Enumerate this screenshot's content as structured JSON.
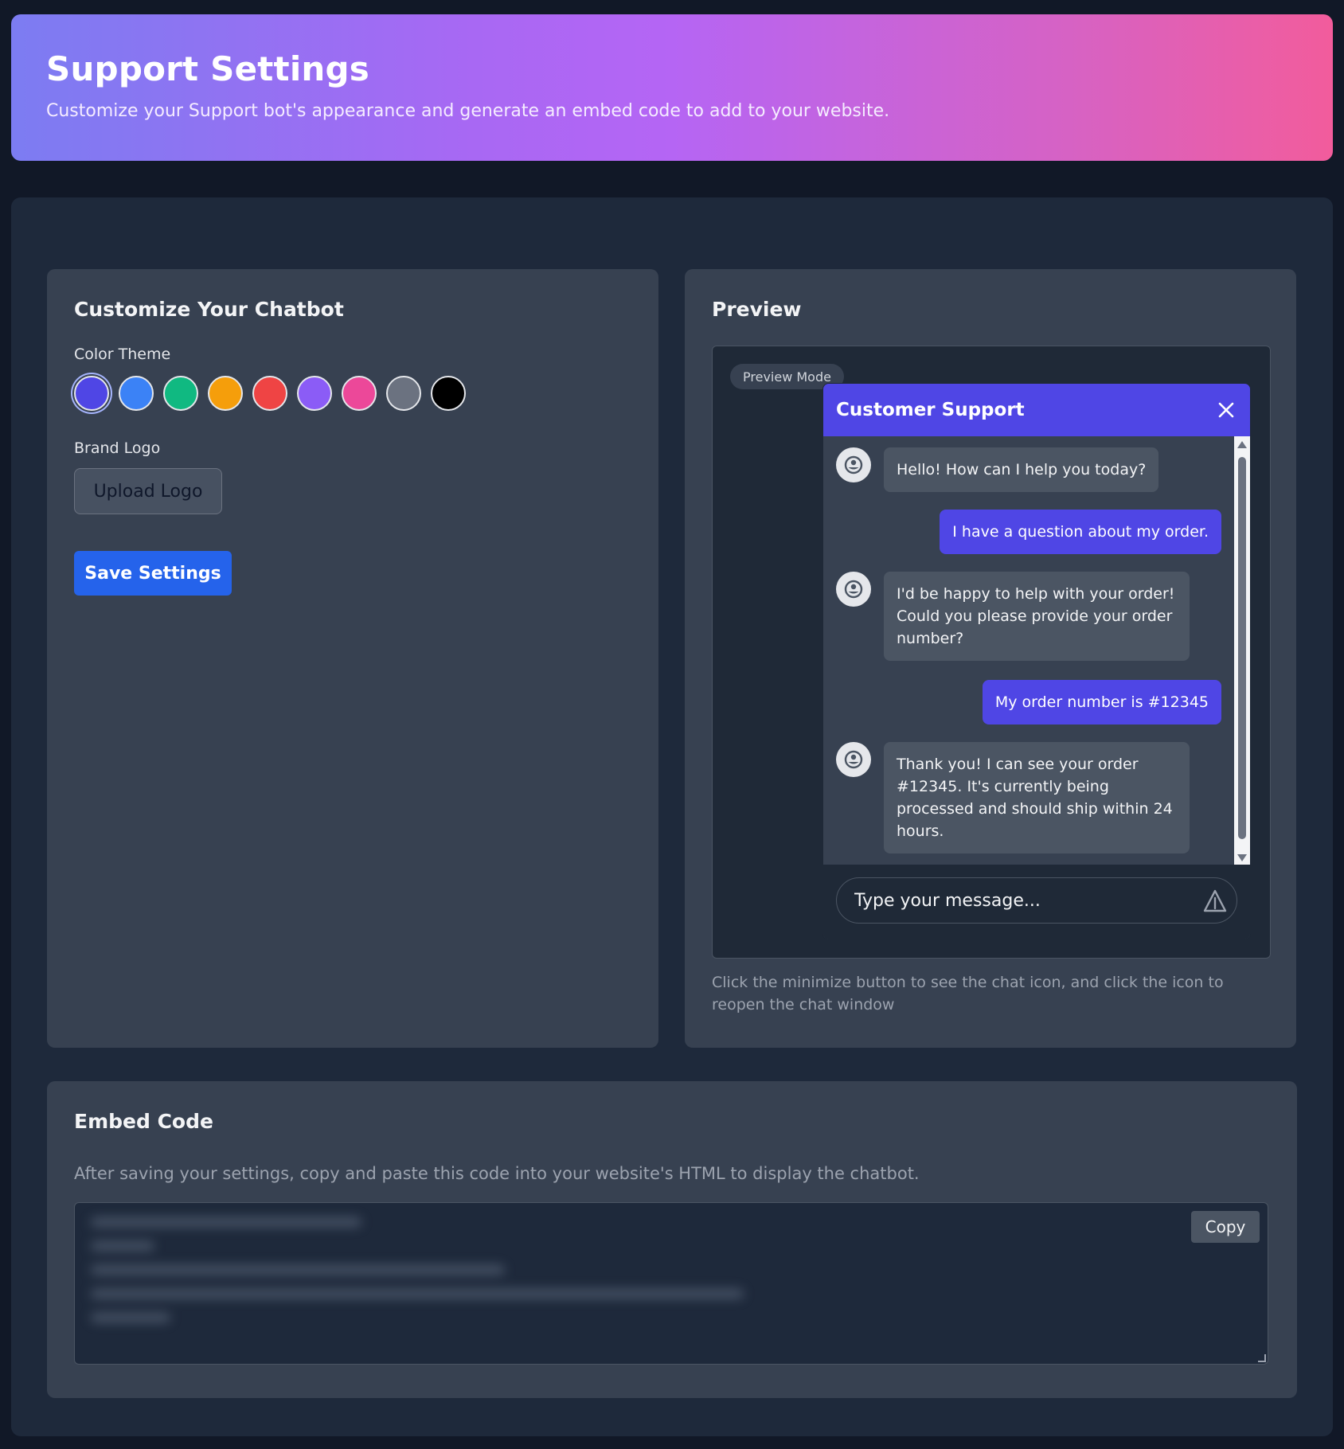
{
  "header": {
    "title": "Support Settings",
    "subtitle": "Customize your Support bot's appearance and generate an embed code to add to your website."
  },
  "customize": {
    "title": "Customize Your Chatbot",
    "color_theme_label": "Color Theme",
    "colors": [
      "#4f46e5",
      "#3b82f6",
      "#10b981",
      "#f59e0b",
      "#ef4444",
      "#8b5cf6",
      "#ec4899",
      "#6b7280",
      "#000000"
    ],
    "selected_color": "#4f46e5",
    "brand_logo_label": "Brand Logo",
    "upload_label": "Upload Logo",
    "save_label": "Save Settings"
  },
  "preview": {
    "title": "Preview",
    "badge": "Preview Mode",
    "chat_title": "Customer Support",
    "messages": [
      {
        "sender": "bot",
        "text": "Hello! How can I help you today?"
      },
      {
        "sender": "user",
        "text": "I have a question about my order."
      },
      {
        "sender": "bot",
        "text": "I'd be happy to help with your order! Could you please provide your order number?"
      },
      {
        "sender": "user",
        "text": "My order number is #12345"
      },
      {
        "sender": "bot",
        "text": "Thank you! I can see your order #12345. It's currently being processed and should ship within 24 hours."
      }
    ],
    "input_placeholder": "Type your message...",
    "hint": "Click the minimize button to see the chat icon, and click the icon to reopen the chat window"
  },
  "embed": {
    "title": "Embed Code",
    "description": "After saving your settings, copy and paste this code into your website's HTML to display the chatbot.",
    "copy_label": "Copy"
  }
}
